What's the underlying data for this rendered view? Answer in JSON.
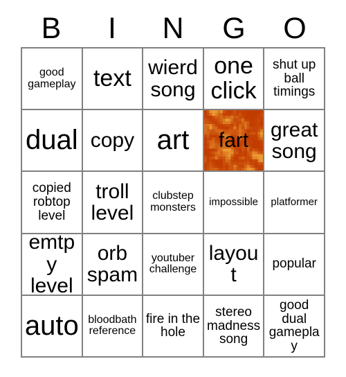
{
  "card": {
    "title": "BINGO",
    "header_letters": [
      "B",
      "I",
      "N",
      "G",
      "O"
    ],
    "columns": 5,
    "rows": 5,
    "border_color": "#808080",
    "cell_background": "#ffffff",
    "text_color": "#000000",
    "marked_color": "#d8500a",
    "marked_color_light": "#eb9a33",
    "marked_color_dark": "#c23c00",
    "cells": [
      {
        "text": "good gameplay",
        "marked": false,
        "size": "xs"
      },
      {
        "text": "text",
        "marked": false,
        "size": "lg"
      },
      {
        "text": "wierd song",
        "marked": false,
        "size": "md"
      },
      {
        "text": "one click",
        "marked": false,
        "size": "lg"
      },
      {
        "text": "shut up ball timings",
        "marked": false,
        "size": "sm"
      },
      {
        "text": "dual",
        "marked": false,
        "size": "xl"
      },
      {
        "text": "copy",
        "marked": false,
        "size": "md"
      },
      {
        "text": "art",
        "marked": false,
        "size": "xl"
      },
      {
        "text": "fart",
        "marked": true,
        "size": "md"
      },
      {
        "text": "great song",
        "marked": false,
        "size": "md"
      },
      {
        "text": "copied robtop level",
        "marked": false,
        "size": "sm"
      },
      {
        "text": "troll level",
        "marked": false,
        "size": "md"
      },
      {
        "text": "clubstep monsters",
        "marked": false,
        "size": "xs"
      },
      {
        "text": "impossible",
        "marked": false,
        "size": "xxs"
      },
      {
        "text": "platformer",
        "marked": false,
        "size": "xxs"
      },
      {
        "text": "emtpy level",
        "marked": false,
        "size": "md"
      },
      {
        "text": "orb spam",
        "marked": false,
        "size": "md"
      },
      {
        "text": "youtuber challenge",
        "marked": false,
        "size": "xs"
      },
      {
        "text": "layout",
        "marked": false,
        "size": "md"
      },
      {
        "text": "popular",
        "marked": false,
        "size": "sm"
      },
      {
        "text": "auto",
        "marked": false,
        "size": "xl"
      },
      {
        "text": "bloodbath reference",
        "marked": false,
        "size": "xs"
      },
      {
        "text": "fire in the hole",
        "marked": false,
        "size": "sm"
      },
      {
        "text": "stereo madness song",
        "marked": false,
        "size": "sm"
      },
      {
        "text": "good dual gameplay",
        "marked": false,
        "size": "sm"
      }
    ]
  }
}
